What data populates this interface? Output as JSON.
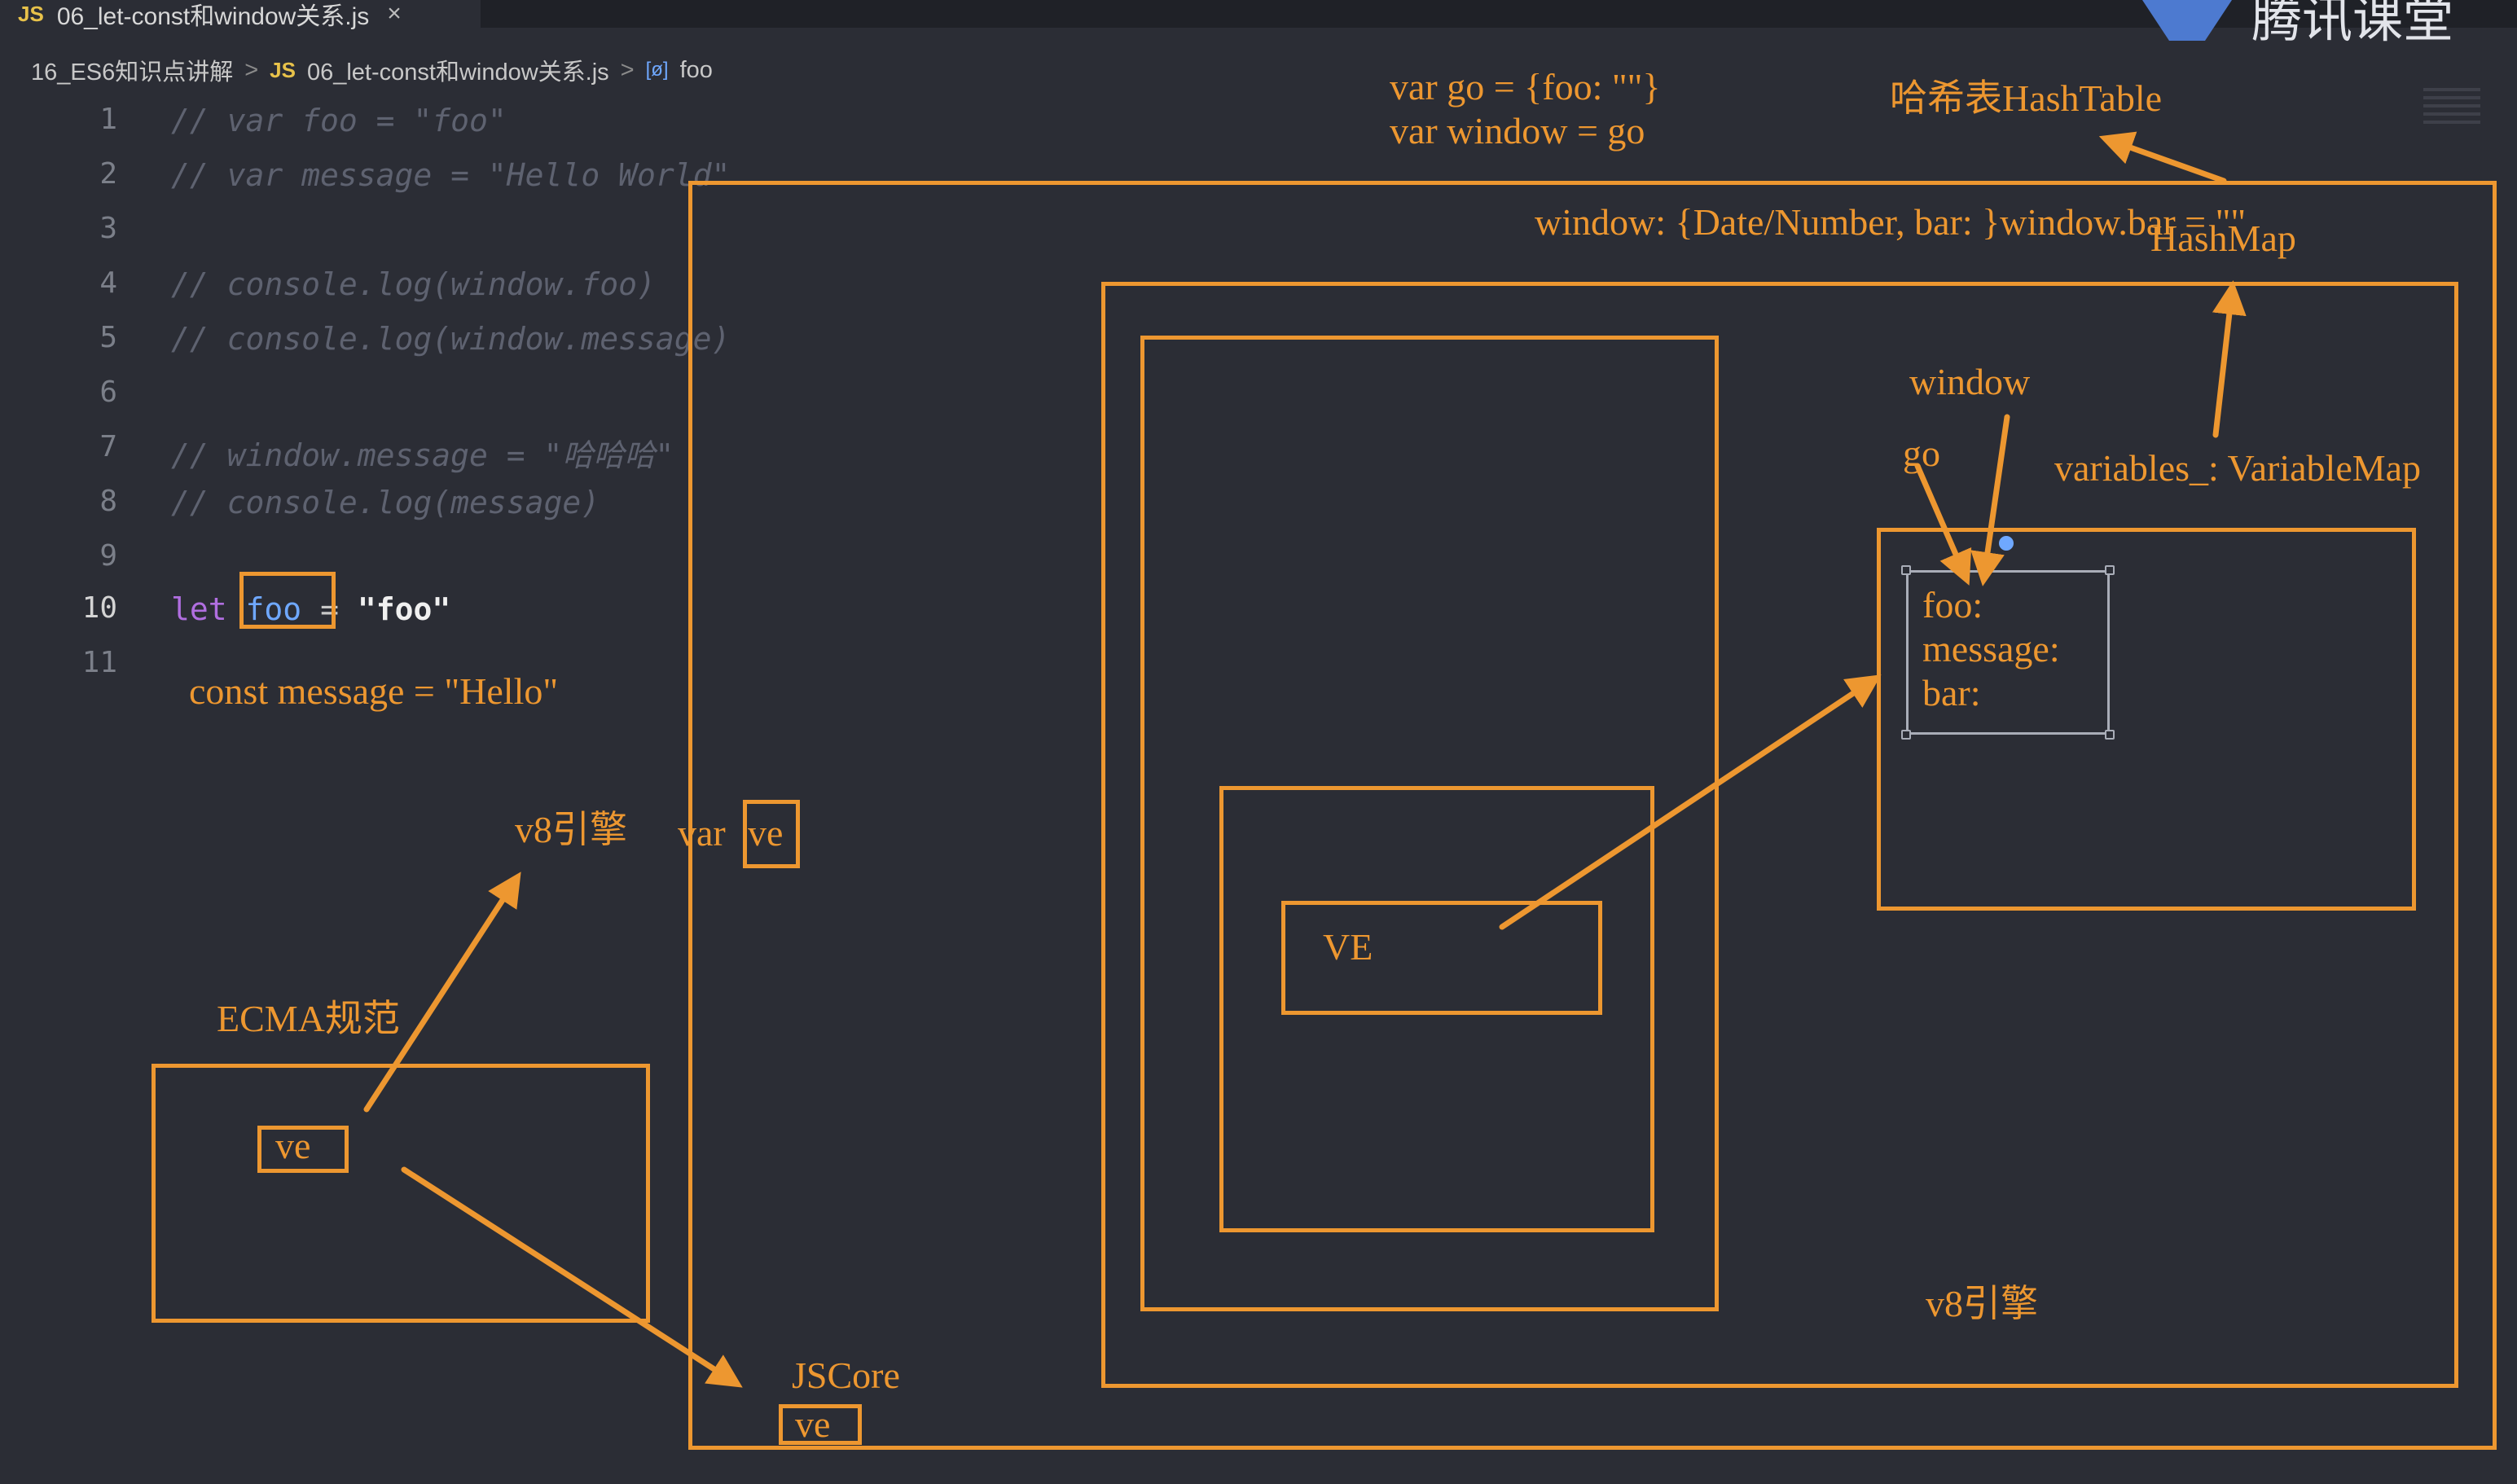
{
  "tab": {
    "lang_badge": "JS",
    "title": "06_let-const和window关系.js",
    "close": "×"
  },
  "breadcrumb": {
    "folder": "16_ES6知识点讲解",
    "lang_badge": "JS",
    "file": "06_let-const和window关系.js",
    "symbol_icon": "[ø]",
    "symbol": "foo",
    "separator": ">"
  },
  "logo": {
    "text": "腾讯课堂"
  },
  "code": [
    {
      "num": "1",
      "text": "// var foo = \"foo\""
    },
    {
      "num": "2",
      "text": "// var message = \"Hello World\""
    },
    {
      "num": "3",
      "text": ""
    },
    {
      "num": "4",
      "text": "// console.log(window.foo)"
    },
    {
      "num": "5",
      "text": "// console.log(window.message)"
    },
    {
      "num": "6",
      "text": ""
    },
    {
      "num": "7",
      "text": "// window.message = \"哈哈哈\""
    },
    {
      "num": "8",
      "text": "// console.log(message)"
    },
    {
      "num": "9",
      "text": ""
    },
    {
      "num": "10",
      "kw": "let",
      "ident": "foo",
      "op": "=",
      "str": "\"foo\""
    },
    {
      "num": "11",
      "text": ""
    }
  ],
  "annotations": {
    "const_message": "const message = \"Hello\"",
    "v8_engine_left": "v8引擎",
    "var_label": "var",
    "ve_box": "ve",
    "ecma": "ECMA规范",
    "ecma_ve": "ve",
    "jscore": "JSCore",
    "jscore_ve": "ve",
    "go_def": "var go = {foo: \"\"}",
    "window_def": "var window = go",
    "hashtable": "哈希表HashTable",
    "window_obj": "window: {Date/Number, bar: }window.bar = \"\"",
    "hashmap": "HashMap",
    "window_label": "window",
    "go_label": "go",
    "variables": "variables_: VariableMap",
    "foo_key": "foo:",
    "message_key": "message:",
    "bar_key": "bar:",
    "ve_upper": "VE",
    "v8_engine_right": "v8引擎"
  },
  "colors": {
    "annotation": "#ed9730",
    "background": "#2b2d35",
    "comment": "#5e6270",
    "keyword": "#b06ee0",
    "identifier": "#6fa8ff"
  }
}
